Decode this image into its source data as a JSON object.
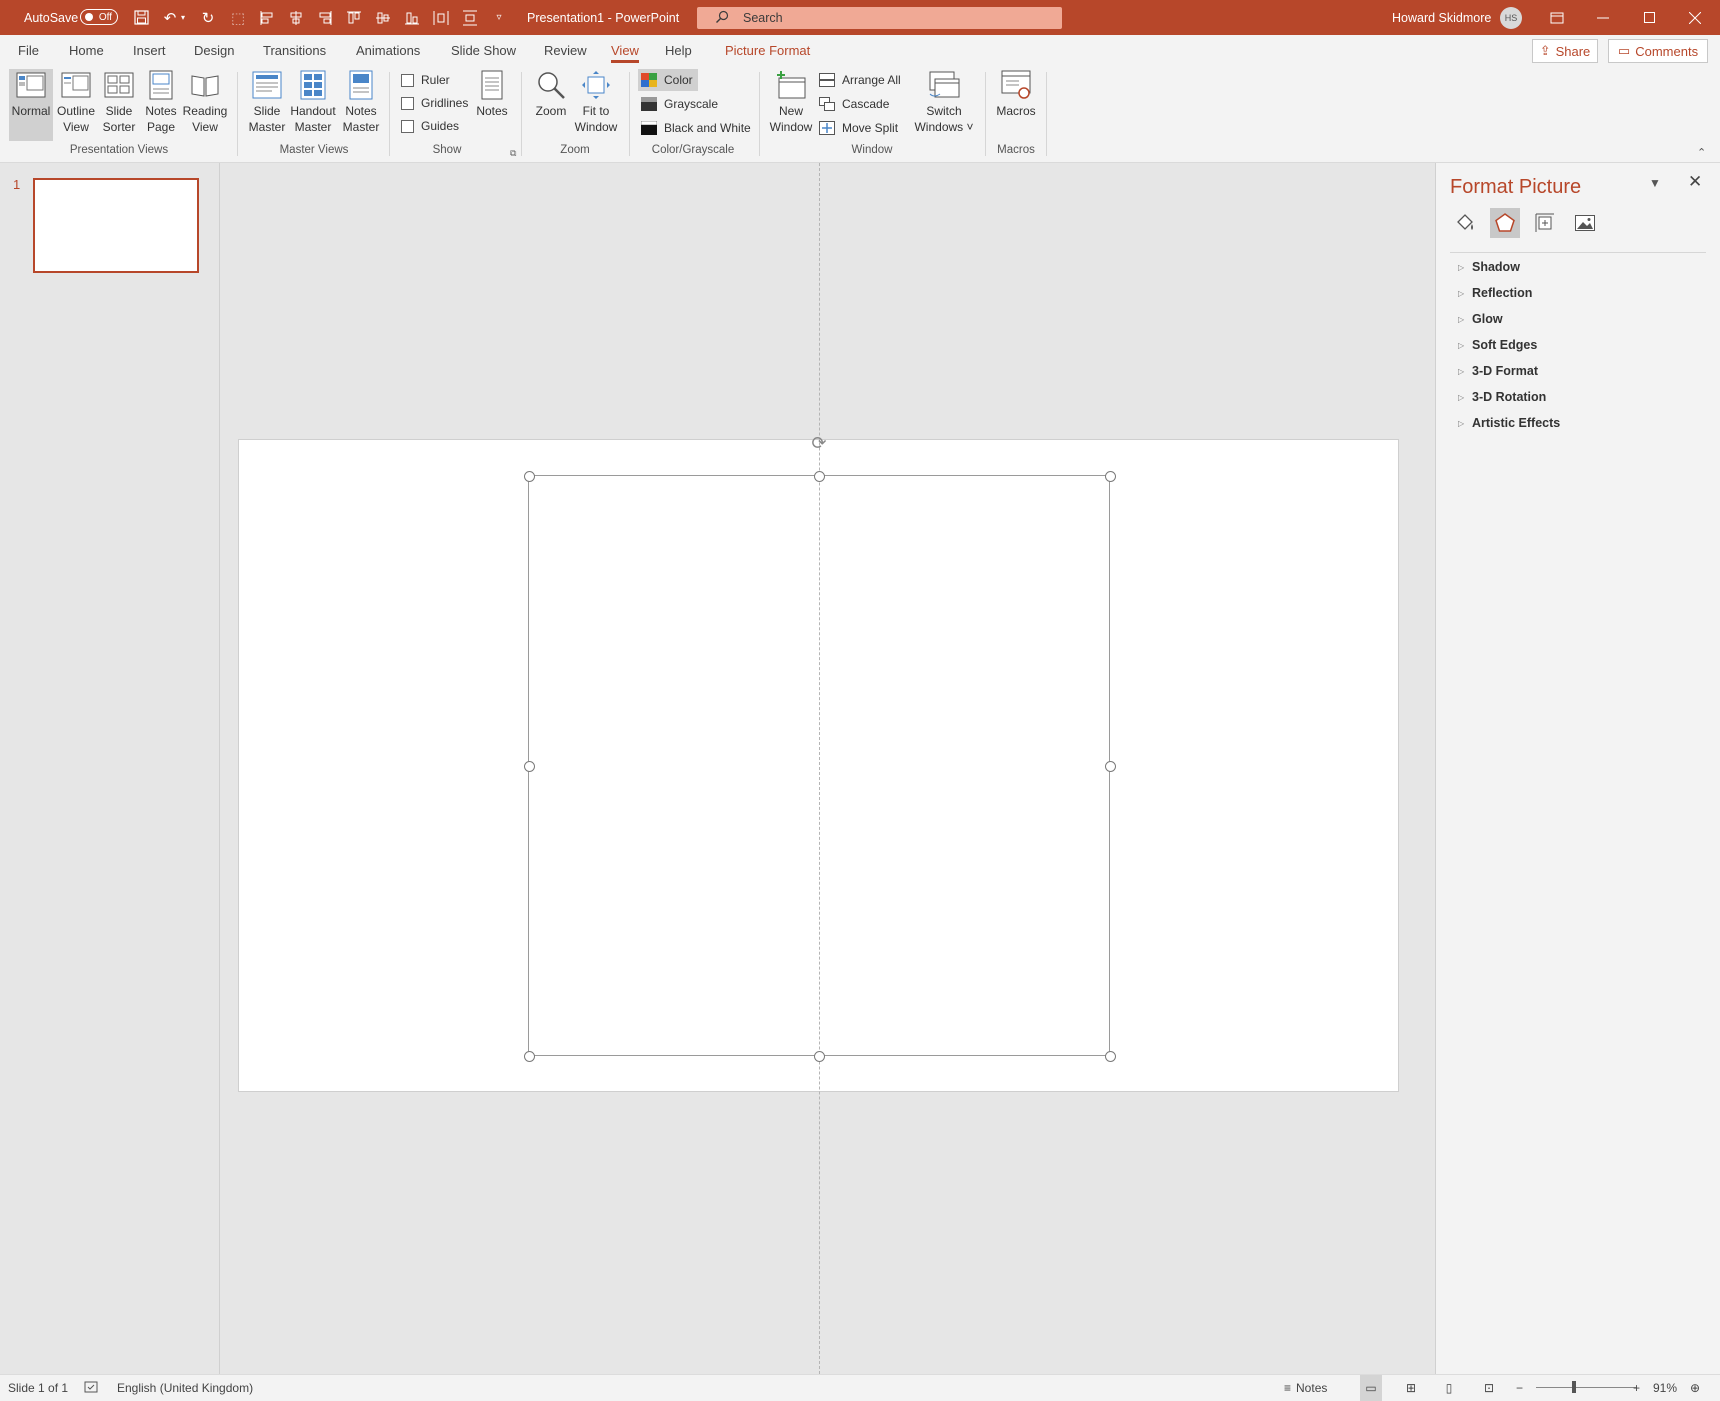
{
  "titlebar": {
    "autosave_label": "AutoSave",
    "autosave_state": "Off",
    "document_title": "Presentation1  -  PowerPoint",
    "search_placeholder": "Search",
    "user_name": "Howard Skidmore",
    "user_initials": "HS",
    "accent_color": "#b7472a"
  },
  "tabs": [
    "File",
    "Home",
    "Insert",
    "Design",
    "Transitions",
    "Animations",
    "Slide Show",
    "Review",
    "View",
    "Help",
    "Picture Format"
  ],
  "active_tab": "View",
  "share_label": "Share",
  "comments_label": "Comments",
  "ribbon": {
    "presentation_views": {
      "label": "Presentation Views",
      "normal": "Normal",
      "outline": [
        "Outline",
        "View"
      ],
      "sorter": [
        "Slide",
        "Sorter"
      ],
      "notes_page": [
        "Notes",
        "Page"
      ],
      "reading": [
        "Reading",
        "View"
      ]
    },
    "master_views": {
      "label": "Master Views",
      "slide_master": [
        "Slide",
        "Master"
      ],
      "handout_master": [
        "Handout",
        "Master"
      ],
      "notes_master": [
        "Notes",
        "Master"
      ]
    },
    "show": {
      "label": "Show",
      "ruler": "Ruler",
      "gridlines": "Gridlines",
      "guides": "Guides",
      "notes": "Notes"
    },
    "zoom": {
      "label": "Zoom",
      "zoom": "Zoom",
      "fit": [
        "Fit to",
        "Window"
      ]
    },
    "color_grayscale": {
      "label": "Color/Grayscale",
      "color": "Color",
      "grayscale": "Grayscale",
      "bw": "Black and White"
    },
    "window": {
      "label": "Window",
      "new_window": [
        "New",
        "Window"
      ],
      "arrange_all": "Arrange All",
      "cascade": "Cascade",
      "move_split": "Move Split",
      "switch_windows": [
        "Switch",
        "Windows ˅"
      ]
    },
    "macros": {
      "label": "Macros",
      "macros": "Macros"
    }
  },
  "thumbnail": {
    "number": "1"
  },
  "format_pane": {
    "title": "Format Picture",
    "sections": [
      "Shadow",
      "Reflection",
      "Glow",
      "Soft Edges",
      "3-D Format",
      "3-D Rotation",
      "Artistic Effects"
    ]
  },
  "statusbar": {
    "slide_info": "Slide 1 of 1",
    "language": "English (United Kingdom)",
    "notes": "Notes",
    "zoom": "91%"
  }
}
